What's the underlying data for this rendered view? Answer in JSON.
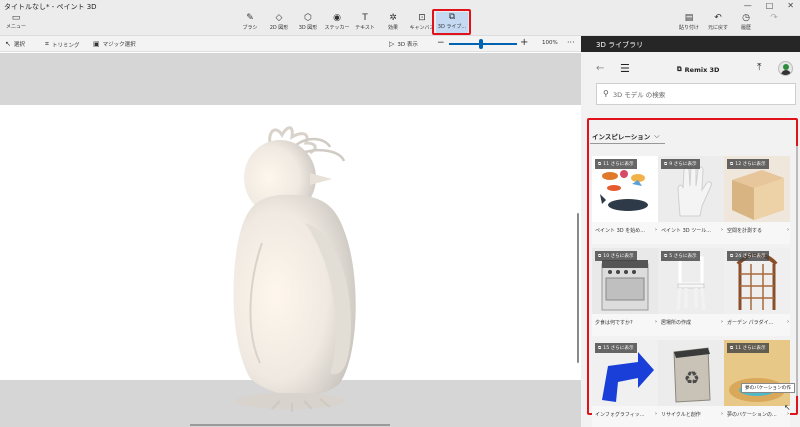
{
  "window": {
    "title": "タイトルなし* - ペイント 3D",
    "controls": [
      "—",
      "□",
      "✕"
    ]
  },
  "ribbon": {
    "menu_label": "メニュー",
    "tools": [
      {
        "id": "brush",
        "label": "ブラシ",
        "icon": "brush-icon",
        "glyph": "✎"
      },
      {
        "id": "2d",
        "label": "2D 図形",
        "icon": "2d-shapes-icon",
        "glyph": "◇"
      },
      {
        "id": "3d",
        "label": "3D 図形",
        "icon": "3d-shapes-icon",
        "glyph": "⬡"
      },
      {
        "id": "sticker",
        "label": "ステッカー",
        "icon": "sticker-icon",
        "glyph": "◉"
      },
      {
        "id": "text",
        "label": "テキスト",
        "icon": "text-icon",
        "glyph": "T"
      },
      {
        "id": "effects",
        "label": "効果",
        "icon": "effects-icon",
        "glyph": "✲"
      },
      {
        "id": "canvas",
        "label": "キャンバス",
        "icon": "canvas-icon",
        "glyph": "⊡"
      },
      {
        "id": "library",
        "label": "3D ライブ...",
        "icon": "3d-library-icon",
        "glyph": "⧉",
        "active": true
      }
    ],
    "right_tools": [
      {
        "label": "貼り付け",
        "icon": "paste-icon",
        "glyph": "📋",
        "disabled": false
      },
      {
        "label": "元に戻す",
        "icon": "undo-icon",
        "glyph": "↶",
        "disabled": false
      },
      {
        "label": "履歴",
        "icon": "history-icon",
        "glyph": "◷",
        "disabled": false
      },
      {
        "label": "",
        "icon": "redo-icon",
        "glyph": "↷",
        "disabled": true
      }
    ]
  },
  "subbar": {
    "select_label": "選択",
    "crop_label": "トリミング",
    "magic_select_label": "マジック選択",
    "view_3d_label": "3D 表示",
    "zoom_level": "100%",
    "zoom_fraction": 0.47
  },
  "panel": {
    "header": "3D ライブラリ",
    "brand": "Remix 3D",
    "search_placeholder": "3D モデル の検索",
    "section_title": "インスピレーション",
    "tiles": [
      {
        "badge": "11 さらに表示",
        "caption": "ペイント 3D を始め...",
        "thumb": "sea-creatures"
      },
      {
        "badge": "9 さらに表示",
        "caption": "ペイント 3D ツール...",
        "thumb": "hand"
      },
      {
        "badge": "12 さらに表示",
        "caption": "空間を計測する",
        "thumb": "wood-box"
      },
      {
        "badge": "10 さらに表示",
        "caption": "夕食は何ですか?",
        "thumb": "stove"
      },
      {
        "badge": "5 さらに表示",
        "caption": "居場所の作成",
        "thumb": "chair"
      },
      {
        "badge": "24 さらに表示",
        "caption": "ガーデン パラダイ...",
        "thumb": "trellis"
      },
      {
        "badge": "15 さらに表示",
        "caption": "インフォグラフィッ...",
        "thumb": "blue-arrow"
      },
      {
        "badge": "",
        "caption": "リサイクルと創作",
        "thumb": "recycle-bin"
      },
      {
        "badge": "11 さらに表示",
        "caption": "夢のバケーションの...",
        "thumb": "island"
      }
    ],
    "tooltip": "夢のバケーションの作"
  },
  "colors": {
    "accent": "#0063b1",
    "highlight": "#e0121b",
    "panel_header": "#262626"
  }
}
